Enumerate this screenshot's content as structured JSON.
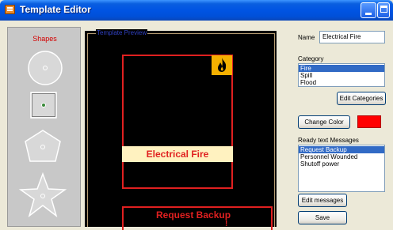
{
  "window": {
    "title": "Template Editor"
  },
  "shapes_panel": {
    "title": "Shapes",
    "items": [
      "circle",
      "square",
      "pentagon",
      "star"
    ]
  },
  "preview": {
    "label": "Template Preview",
    "sign_caption": "Electrical Fire",
    "icon": "fire-icon",
    "message_text": "Request Backup",
    "message_text_line2": "!"
  },
  "properties": {
    "name_label": "Name",
    "name_value": "Electrical Fire",
    "category_label": "Category",
    "categories": [
      {
        "label": "Fire",
        "selected": true
      },
      {
        "label": "Spill",
        "selected": false
      },
      {
        "label": "Flood",
        "selected": false
      }
    ],
    "edit_categories_label": "Edit Categories",
    "change_color_label": "Change Color",
    "color": "#ff0000",
    "messages_label": "Ready text Messages",
    "messages": [
      {
        "label": "Request Backup",
        "selected": true
      },
      {
        "label": "Personnel Wounded",
        "selected": false
      },
      {
        "label": "Shutoff power",
        "selected": false
      }
    ],
    "edit_messages_label": "Edit messages",
    "save_label": "Save"
  },
  "colors": {
    "title_bar": "#0054e3",
    "accent_red": "#e02020",
    "fire_badge": "#f4b000",
    "selection": "#316ac5"
  }
}
